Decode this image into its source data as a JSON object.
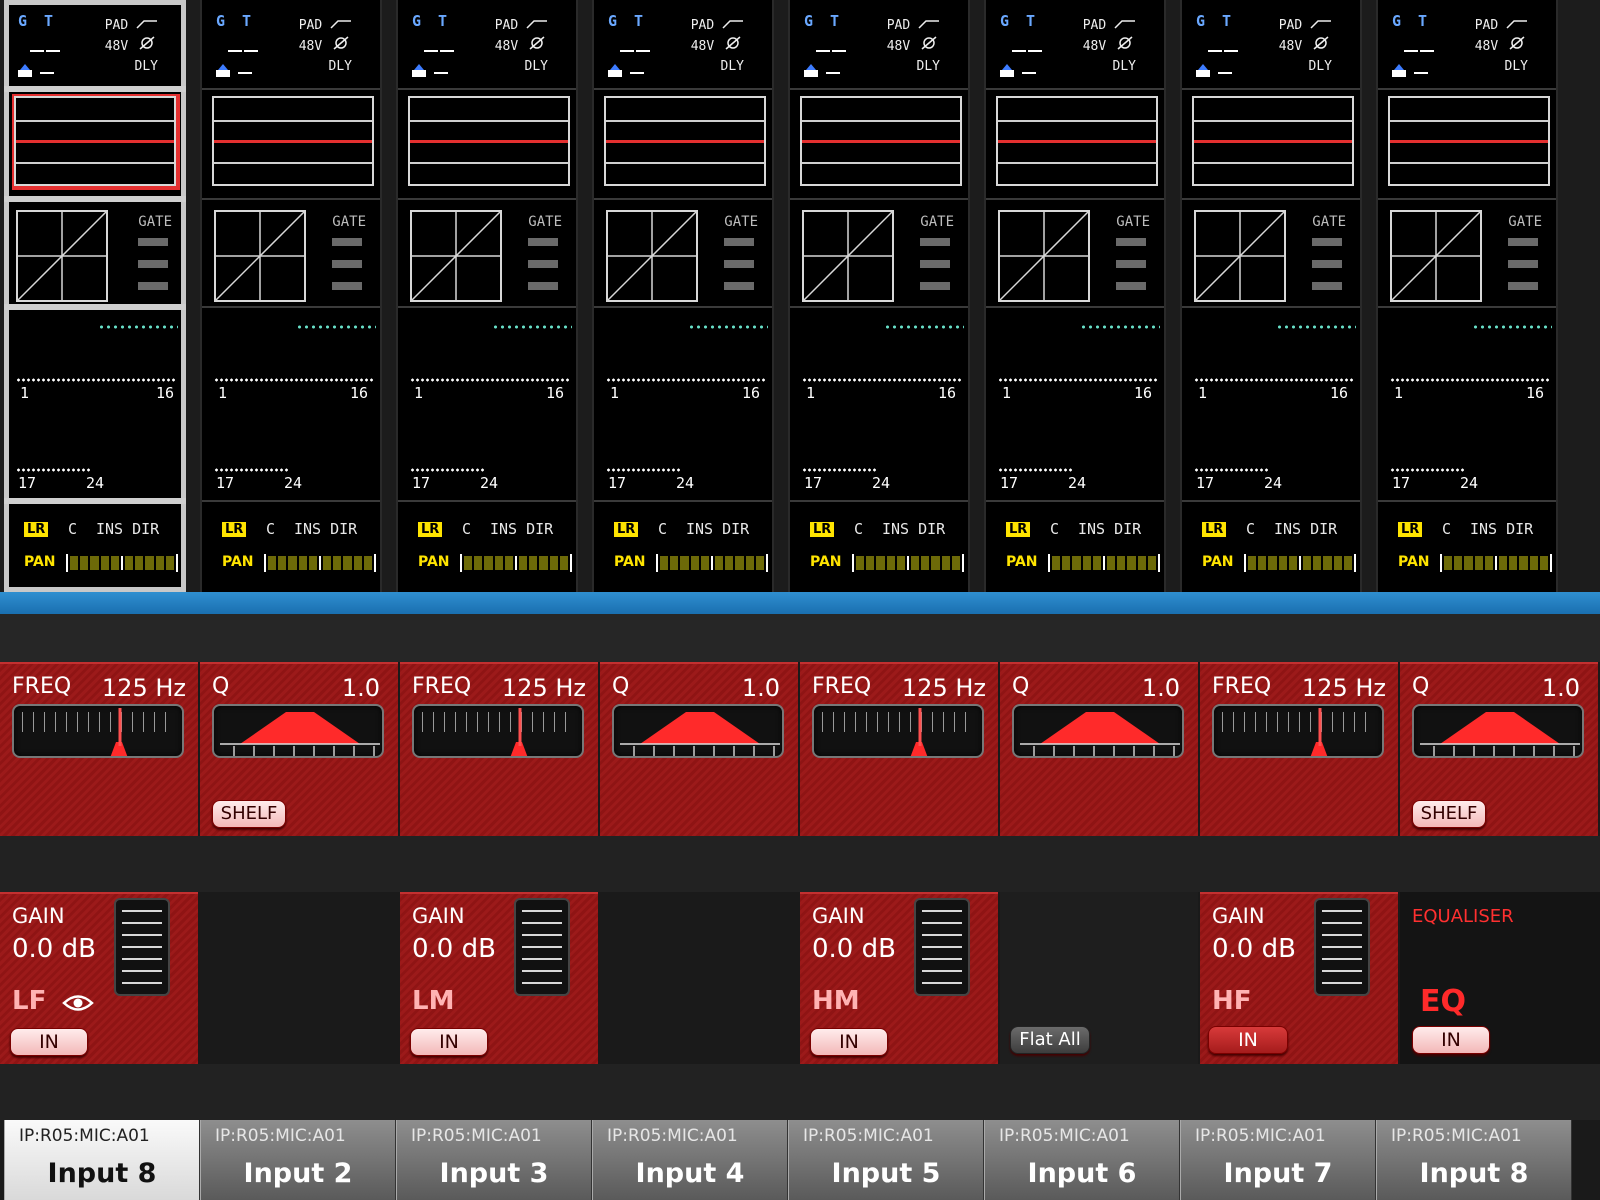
{
  "strip_labels": {
    "gt": "G T",
    "pad": "PAD",
    "v48": "48V",
    "dly": "DLY",
    "gate": "GATE",
    "bus_start": "1",
    "bus_end": "16",
    "bus2_start": "17",
    "bus2_end": "24",
    "lr": "LR",
    "c": "C",
    "ins_dir": "INS DIR",
    "pan": "PAN"
  },
  "eq": {
    "freq_label": "FREQ",
    "freq_value": "125 Hz",
    "q_label": "Q",
    "q_value": "1.0",
    "shelf": "SHELF",
    "gain_label": "GAIN",
    "gain_value": "0.0 dB",
    "in": "IN",
    "flat_all": "Flat All",
    "bands": [
      "LF",
      "LM",
      "HM",
      "HF"
    ],
    "equaliser_title": "EQUALISER",
    "eq_label": "EQ"
  },
  "tabs": [
    {
      "route": "IP:R05:MIC:A01",
      "name": "Input 8"
    },
    {
      "route": "IP:R05:MIC:A01",
      "name": "Input 2"
    },
    {
      "route": "IP:R05:MIC:A01",
      "name": "Input 3"
    },
    {
      "route": "IP:R05:MIC:A01",
      "name": "Input 4"
    },
    {
      "route": "IP:R05:MIC:A01",
      "name": "Input 5"
    },
    {
      "route": "IP:R05:MIC:A01",
      "name": "Input 6"
    },
    {
      "route": "IP:R05:MIC:A01",
      "name": "Input 7"
    },
    {
      "route": "IP:R05:MIC:A01",
      "name": "Input 8"
    }
  ],
  "colors": {
    "accent_red": "#e53030",
    "panel_red": "#9c1a1a",
    "lr_yellow": "#ffe400",
    "blue_band": "#2f8fd0"
  },
  "icons": {
    "eye": "eye-icon",
    "mic": "mic-icon",
    "phase": "phase-icon",
    "highpass": "highpass-icon"
  }
}
